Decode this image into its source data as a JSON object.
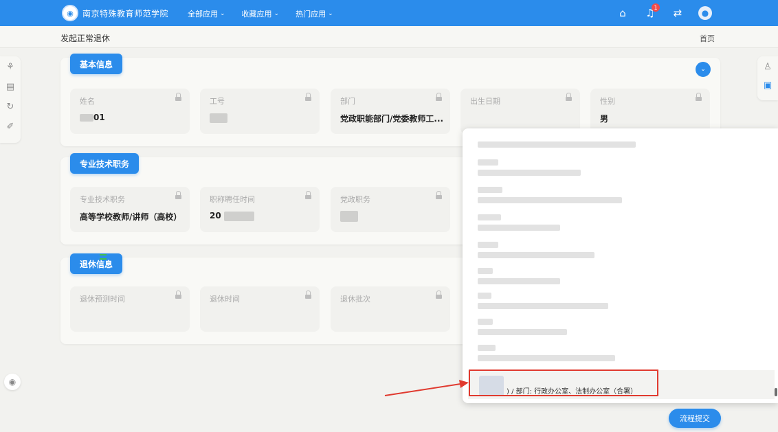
{
  "header": {
    "school_name": "南京特殊教育师范学院",
    "logo_glyph": "◉",
    "nav": [
      {
        "label": "全部应用",
        "chevron": "⌄"
      },
      {
        "label": "收藏应用",
        "chevron": "⌄"
      },
      {
        "label": "热门应用",
        "chevron": "⌄"
      }
    ],
    "home_icon": "⌂",
    "bell_icon": "♫",
    "bell_badge": "1",
    "switch_icon": "⇄",
    "avatar_icon": "●"
  },
  "subheader": {
    "page_title": "发起正常退休",
    "home_link": "首页"
  },
  "left_rail": [
    "⚘",
    "▤",
    "↻",
    "✐"
  ],
  "left_bottom_icon": "◉",
  "right_rail": [
    "♙",
    "▣"
  ],
  "sections": {
    "basic": {
      "title": "基本信息",
      "collapse_icon": "⌄",
      "fields": [
        {
          "label": "姓名",
          "value": "01"
        },
        {
          "label": "工号",
          "value": ""
        },
        {
          "label": "部门",
          "value": "党政职能部门/党委教师工..."
        },
        {
          "label": "出生日期",
          "value": ""
        },
        {
          "label": "性别",
          "value": "男"
        }
      ]
    },
    "tech": {
      "title": "专业技术职务",
      "fields": [
        {
          "label": "专业技术职务",
          "value": "高等学校教师/讲师（高校）"
        },
        {
          "label": "职称聘任时间",
          "value": "20"
        },
        {
          "label": "党政职务",
          "value": ""
        }
      ]
    },
    "retire": {
      "title": "退休信息",
      "fields": [
        {
          "label": "退休预测时间",
          "value": ""
        },
        {
          "label": "退休时间",
          "value": ""
        },
        {
          "label": "退休批次",
          "value": ""
        }
      ]
    }
  },
  "popup": {
    "selected_text": ") / 部门: 行政办公室、法制办公室（合署）"
  },
  "actions": {
    "submit_label": "流程提交"
  }
}
